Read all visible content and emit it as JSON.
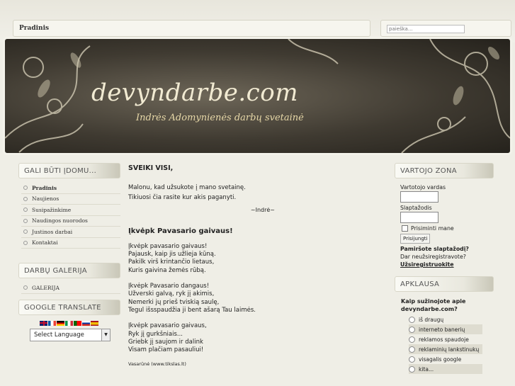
{
  "header": {
    "breadcrumb": "Pradinis",
    "search_placeholder": "paieška..."
  },
  "banner": {
    "title": "devyndarbe.com",
    "subtitle": "Indrės Adomynienės darbų svetainė"
  },
  "left": {
    "menu_heading": "GALI BŪTI ĮDOMU...",
    "menu": [
      "Pradinis",
      "Naujienos",
      "Susipažinkime",
      "Naudingos nuorodos",
      "Justinos darbai",
      "Kontaktai"
    ],
    "gallery_heading": "DARBŲ GALERIJA",
    "gallery_items": [
      "GALERIJA"
    ],
    "translate_heading": "GOOGLE TRANSLATE",
    "language_select": "Select Language",
    "flag_icons": [
      "flag-gb-icon",
      "flag-fr-icon",
      "flag-de-icon",
      "flag-it-icon",
      "flag-pt-icon",
      "flag-ru-icon",
      "flag-es-icon"
    ]
  },
  "main": {
    "heading": "SVEIKI VISI,",
    "intro1": "Malonu, kad užsukote į mano svetainę.",
    "intro2": "Tikiuosi čia rasite kur akis paganyti.",
    "signature": "~Indrė~",
    "poem_title": "Įkvėpk Pavasario gaivaus!",
    "stanzas": [
      [
        "Įkvėpk pavasario gaivaus!",
        "Pajausk, kaip jis užlieja kūną.",
        "Pakilk virš krintančio lietaus,",
        "Kuris gaivina žemės rūbą."
      ],
      [
        "Įkvėpk Pavasario dangaus!",
        "Užverski galvą, ryk jį akimis,",
        "Nemerki jų prieš tviskią saulę,",
        "Tegul išsspaudžia ji bent ašarą Tau laimės."
      ],
      [
        "Įkvėpk pavasario gaivaus,",
        "Ryk jį gurkšniais...",
        "Griebk jį saujom ir dalink",
        "Visam plačiam pasauliui!"
      ]
    ],
    "credit": "Vasarūnė (www.tikslas.lt)"
  },
  "right": {
    "login_heading": "VARTOJO ZONA",
    "username_label": "Vartotojo vardas",
    "password_label": "Slaptažodis",
    "remember_label": "Prisiminti mane",
    "login_button": "Prisijungti",
    "forgot": "Pamiršote slaptažodį?",
    "not_registered": "Dar neužsiregistravote?",
    "register": "Užsiregistruokite",
    "poll_heading": "APKLAUSA",
    "poll_question": "Kaip sužinojote apie devyndarbe.com?",
    "poll_options": [
      "iš draugų",
      "interneto banerių",
      "reklamos spaudoje",
      "reklaminių lankstinukų",
      "visagalis google",
      "kita..."
    ]
  }
}
